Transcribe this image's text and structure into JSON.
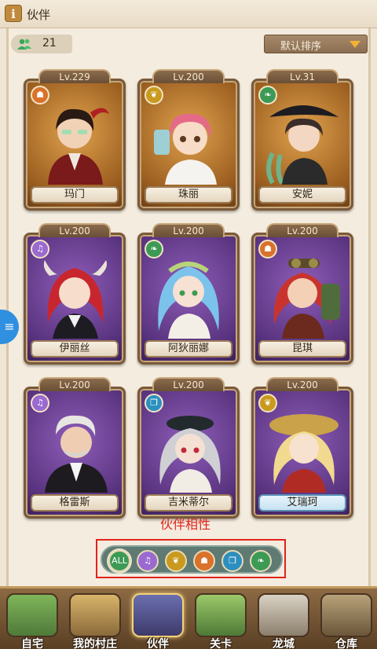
{
  "header": {
    "title": "伙伴",
    "info_icon": "info-icon"
  },
  "toolbar": {
    "count": "21",
    "sort_label": "默认排序"
  },
  "cards": [
    {
      "level": "Lv.229",
      "name": "玛门",
      "frame": "gold",
      "attr_icon": "demon-icon",
      "attr_color": "#d9722b"
    },
    {
      "level": "Lv.200",
      "name": "珠丽",
      "frame": "gold",
      "attr_icon": "wheat-icon",
      "attr_color": "#c99a1e"
    },
    {
      "level": "Lv.31",
      "name": "安妮",
      "frame": "gold",
      "attr_icon": "leaf-icon",
      "attr_color": "#3c9a55"
    },
    {
      "level": "Lv.200",
      "name": "伊丽丝",
      "frame": "purple",
      "attr_icon": "harp-icon",
      "attr_color": "#9a6ad0"
    },
    {
      "level": "Lv.200",
      "name": "阿狄丽娜",
      "frame": "purple",
      "attr_icon": "leaf-icon",
      "attr_color": "#3c9a55"
    },
    {
      "level": "Lv.200",
      "name": "昆琪",
      "frame": "purple",
      "attr_icon": "demon-icon",
      "attr_color": "#d9722b"
    },
    {
      "level": "Lv.200",
      "name": "格雷斯",
      "frame": "purple",
      "attr_icon": "harp-icon",
      "attr_color": "#9a6ad0"
    },
    {
      "level": "Lv.200",
      "name": "吉米蒂尔",
      "frame": "purple",
      "attr_icon": "book-icon",
      "attr_color": "#2c8fbf"
    },
    {
      "level": "Lv.200",
      "name": "艾瑞珂",
      "frame": "purple",
      "attr_icon": "wheat-icon",
      "attr_color": "#c99a1e"
    }
  ],
  "attribute_section": {
    "caption": "伙伴相性",
    "filters": [
      {
        "label": "ALL",
        "icon": "all-icon",
        "color": "#3c9a55"
      },
      {
        "label": "",
        "icon": "harp-icon",
        "color": "#9a6ad0"
      },
      {
        "label": "",
        "icon": "wheat-icon",
        "color": "#c99a1e"
      },
      {
        "label": "",
        "icon": "demon-icon",
        "color": "#d9722b"
      },
      {
        "label": "",
        "icon": "book-icon",
        "color": "#2c8fbf"
      },
      {
        "label": "",
        "icon": "leaf-icon",
        "color": "#3c9a55"
      }
    ]
  },
  "nav": [
    {
      "label": "自宅",
      "icon": "home-icon"
    },
    {
      "label": "我的村庄",
      "icon": "village-icon"
    },
    {
      "label": "伙伴",
      "icon": "partner-icon",
      "active": true
    },
    {
      "label": "关卡",
      "icon": "stage-icon"
    },
    {
      "label": "龙城",
      "icon": "dragon-city-icon"
    },
    {
      "label": "仓库",
      "icon": "warehouse-icon"
    }
  ]
}
